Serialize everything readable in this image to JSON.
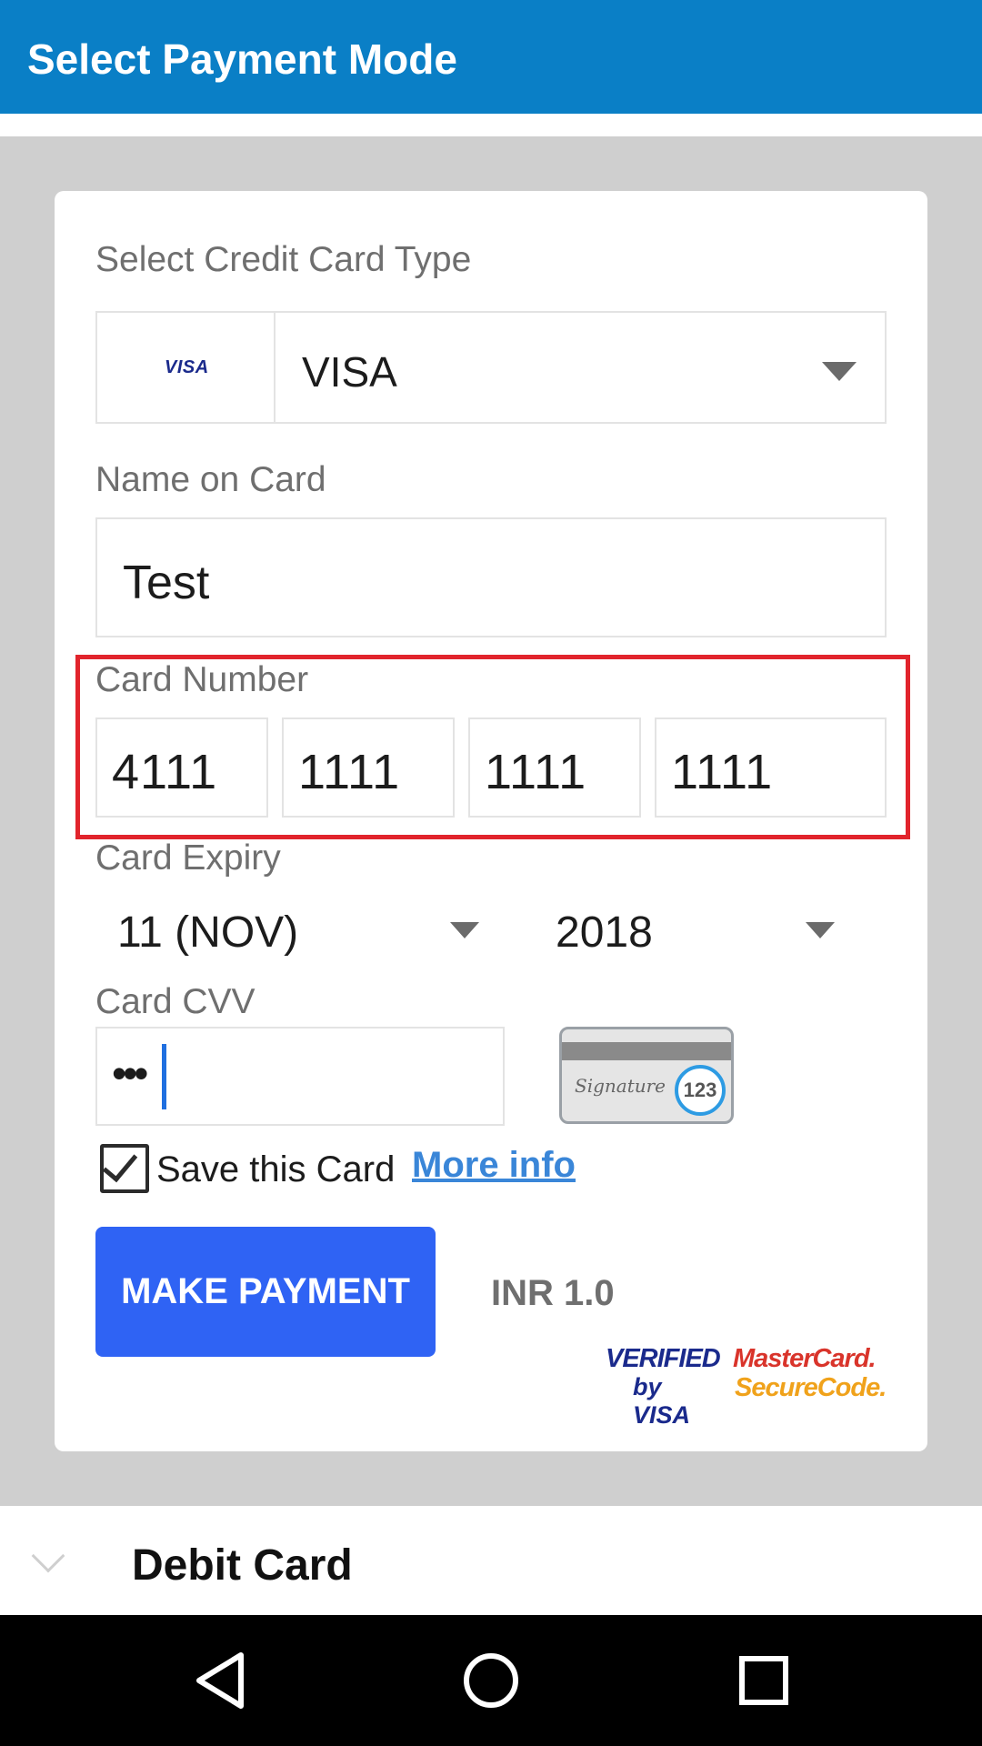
{
  "appbar": {
    "title": "Select Payment Mode",
    "color": "#0a7fc6"
  },
  "credit_card_form": {
    "card_type": {
      "label": "Select Credit Card Type",
      "logo_text": "VISA",
      "selected": "VISA",
      "icon": "chevron-down-icon"
    },
    "name_on_card": {
      "label": "Name on Card",
      "value": "Test"
    },
    "card_number": {
      "label": "Card Number",
      "segments": [
        "4111",
        "1111",
        "1111",
        "1111"
      ],
      "highlight_color": "#e1242c"
    },
    "card_expiry": {
      "label": "Card Expiry",
      "month": "11 (NOV)",
      "year": "2018"
    },
    "card_cvv": {
      "label": "Card CVV",
      "masked_value": "•••",
      "helper_image": {
        "signature_text": "Signature",
        "code": "123"
      }
    },
    "save_card": {
      "label": "Save this Card",
      "checked": true,
      "more_info": "More info"
    },
    "make_payment": {
      "label": "MAKE PAYMENT",
      "color": "#2f63f4"
    },
    "amount": "INR 1.0",
    "badges": {
      "verified_by_visa": {
        "line1": "VERIFIED",
        "line2": "by VISA"
      },
      "mastercard_securecode": {
        "line1": "MasterCard.",
        "line2": "SecureCode."
      }
    }
  },
  "debit_card_section": {
    "label": "Debit Card",
    "icon": "chevron-down-icon"
  },
  "navbar": {
    "back": "back-icon",
    "home": "home-icon",
    "recents": "recents-icon"
  }
}
